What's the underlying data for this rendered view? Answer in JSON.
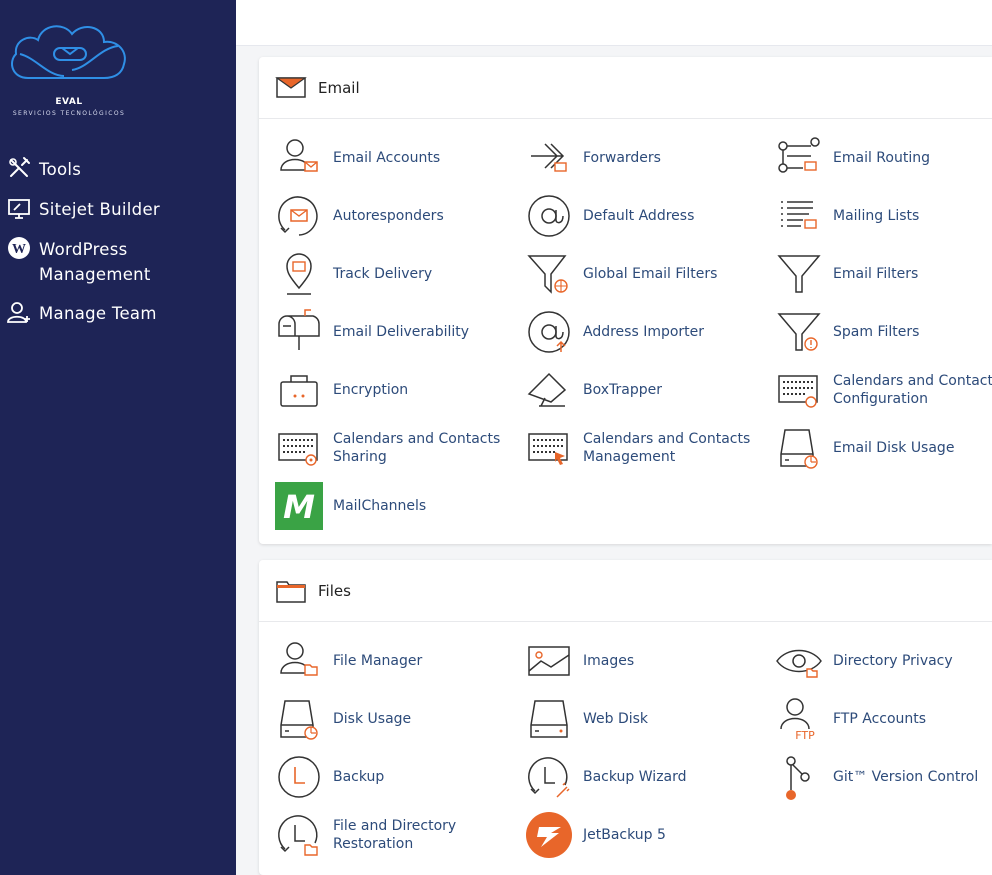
{
  "brand": {
    "name": "EVAL",
    "tagline": "SERVICIOS TECNOLÓGICOS"
  },
  "sidebar": {
    "items": [
      {
        "label": "Tools",
        "icon": "tools-icon"
      },
      {
        "label": "Sitejet Builder",
        "icon": "monitor-icon"
      },
      {
        "label": "WordPress Management",
        "icon": "wordpress-icon"
      },
      {
        "label": "Manage Team",
        "icon": "user-add-icon"
      }
    ]
  },
  "email": {
    "title": "Email",
    "items": [
      {
        "label": "Email Accounts",
        "icon": "user-mail-icon"
      },
      {
        "label": "Forwarders",
        "icon": "forward-icon"
      },
      {
        "label": "Email Routing",
        "icon": "routing-icon"
      },
      {
        "label": "Autoresponders",
        "icon": "autoresponder-icon"
      },
      {
        "label": "Default Address",
        "icon": "at-icon"
      },
      {
        "label": "Mailing Lists",
        "icon": "list-icon"
      },
      {
        "label": "Track Delivery",
        "icon": "location-icon"
      },
      {
        "label": "Global Email Filters",
        "icon": "filter-globe-icon"
      },
      {
        "label": "Email Filters",
        "icon": "filter-icon"
      },
      {
        "label": "Email Deliverability",
        "icon": "mailbox-icon"
      },
      {
        "label": "Address Importer",
        "icon": "at-import-icon"
      },
      {
        "label": "Spam Filters",
        "icon": "filter-warning-icon"
      },
      {
        "label": "Encryption",
        "icon": "key-icon"
      },
      {
        "label": "BoxTrapper",
        "icon": "trap-icon"
      },
      {
        "label": "Calendars and Contacts Configuration",
        "icon": "calendar-at-icon"
      },
      {
        "label": "Calendars and Contacts Sharing",
        "icon": "calendar-gear-icon"
      },
      {
        "label": "Calendars and Contacts Management",
        "icon": "calendar-cursor-icon"
      },
      {
        "label": "Email Disk Usage",
        "icon": "disk-usage-icon"
      },
      {
        "label": "MailChannels",
        "icon": "mailchannels-logo-icon"
      }
    ]
  },
  "files": {
    "title": "Files",
    "items": [
      {
        "label": "File Manager",
        "icon": "user-folder-icon"
      },
      {
        "label": "Images",
        "icon": "image-icon"
      },
      {
        "label": "Directory Privacy",
        "icon": "eye-icon"
      },
      {
        "label": "Disk Usage",
        "icon": "disk-icon"
      },
      {
        "label": "Web Disk",
        "icon": "web-disk-icon"
      },
      {
        "label": "FTP Accounts",
        "icon": "ftp-user-icon"
      },
      {
        "label": "Backup",
        "icon": "backup-clock-icon"
      },
      {
        "label": "Backup Wizard",
        "icon": "backup-wizard-icon"
      },
      {
        "label": "Git™ Version Control",
        "icon": "git-icon"
      },
      {
        "label": "File and Directory Restoration",
        "icon": "restore-icon"
      },
      {
        "label": "JetBackup 5",
        "icon": "jetbackup-logo-icon"
      }
    ]
  },
  "colors": {
    "sidebar": "#1e2456",
    "accent": "#e8662a",
    "link": "#2d4b7a",
    "mailchannels": "#3aa345"
  }
}
